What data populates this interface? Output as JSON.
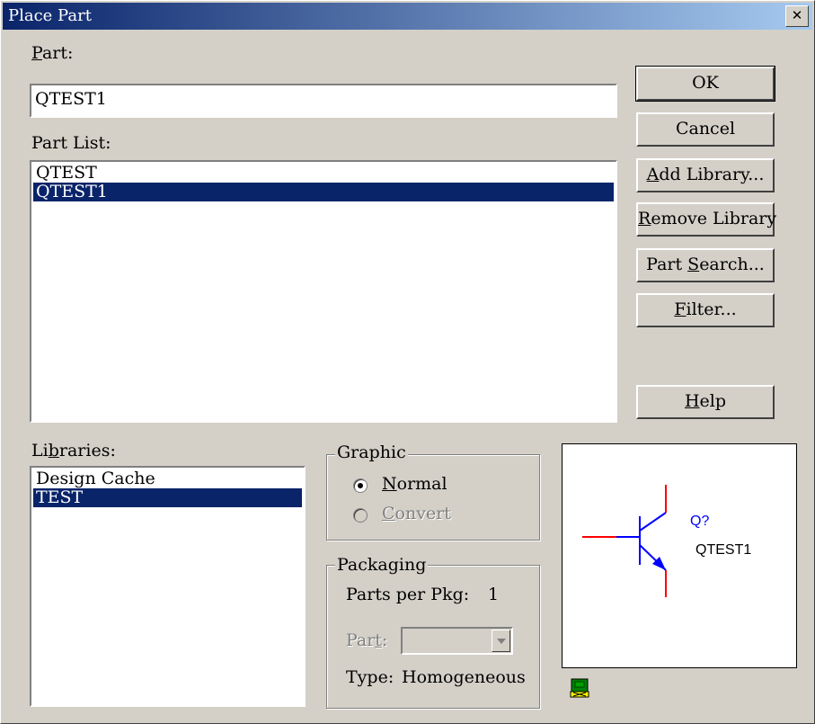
{
  "window": {
    "title": "Place Part",
    "close_glyph": "✕"
  },
  "part": {
    "label_prefix": "",
    "label_mnemonic": "P",
    "label_rest": "art:",
    "value": "QTEST1"
  },
  "part_list": {
    "label": "Part List:",
    "items": [
      {
        "text": "QTEST",
        "selected": false
      },
      {
        "text": "QTEST1",
        "selected": true
      }
    ]
  },
  "libraries": {
    "label_prefix": "Li",
    "label_mnemonic": "b",
    "label_rest": "raries:",
    "items": [
      {
        "text": "Design Cache",
        "selected": false
      },
      {
        "text": "TEST",
        "selected": true
      }
    ]
  },
  "buttons": {
    "ok": "OK",
    "cancel": "Cancel",
    "add_library": {
      "mn": "A",
      "rest": "dd Library..."
    },
    "remove_library": {
      "mn": "R",
      "rest": "emove Library"
    },
    "part_search": {
      "pre": "Part ",
      "mn": "S",
      "rest": "earch..."
    },
    "filter": {
      "mn": "F",
      "rest": "ilter..."
    },
    "help": {
      "mn": "H",
      "rest": "elp"
    }
  },
  "graphic": {
    "legend": "Graphic",
    "normal": {
      "mn": "N",
      "rest": "ormal",
      "checked": true
    },
    "convert": {
      "mn": "C",
      "rest": "onvert",
      "checked": false,
      "disabled": true
    }
  },
  "packaging": {
    "legend": "Packaging",
    "parts_per_pkg_label": "Parts per Pkg:",
    "parts_per_pkg_value": "1",
    "part_label_mn": "t",
    "part_label_pre": "Par",
    "part_label_post": ":",
    "part_value": "",
    "type_label": "Type:",
    "type_value": "Homogeneous"
  },
  "preview": {
    "ref": "Q?",
    "name": "QTEST1",
    "colors": {
      "body": "#0000ff",
      "pins": "#ff0000",
      "text": "#000000",
      "ref_text": "#0000ff"
    }
  },
  "status_icon": "library-status-icon",
  "colors": {
    "dialog_bg": "#d4d0c8",
    "title_start": "#0a246a",
    "title_end": "#a6caf0",
    "selection": "#0a246a"
  }
}
